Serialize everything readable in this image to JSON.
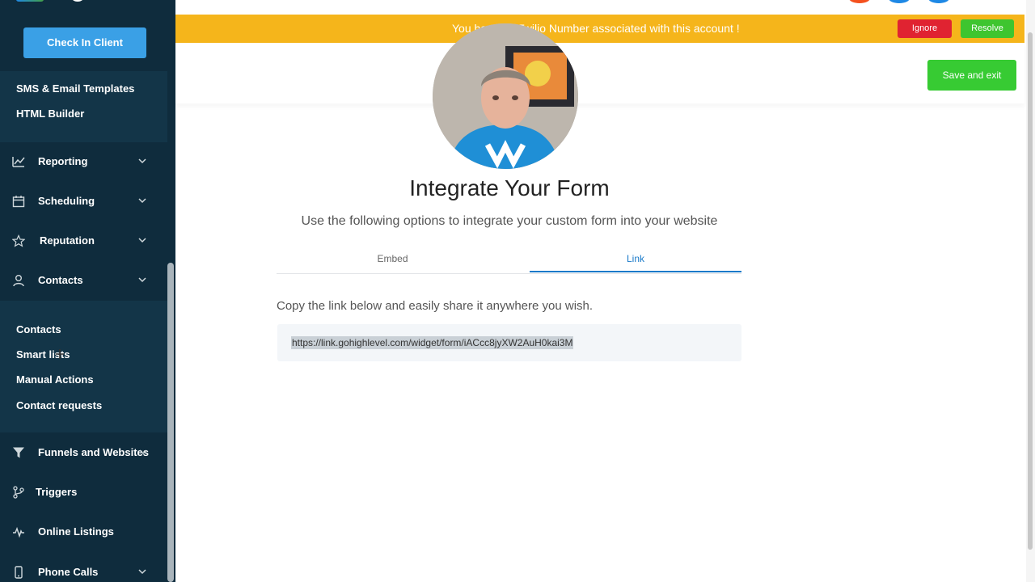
{
  "sidebar": {
    "check_in_label": "Check In Client",
    "marketing_sub_items": [
      "SMS & Email Templates",
      "HTML Builder"
    ],
    "nav": {
      "reporting": "Reporting",
      "scheduling": "Scheduling",
      "reputation": "Reputation",
      "contacts": "Contacts",
      "funnels": "Funnels and Websites",
      "triggers": "Triggers",
      "online_listings": "Online Listings",
      "phone_calls": "Phone Calls"
    },
    "contacts_sub_items": [
      "Contacts",
      "Smart lists",
      "Manual Actions",
      "Contact requests"
    ]
  },
  "banner": {
    "text": "You have no Twilio Number associated with this account !",
    "ignore_label": "Ignore",
    "resolve_label": "Resolve"
  },
  "header": {
    "save_exit_label": "Save and exit"
  },
  "main": {
    "title": "Integrate Your Form",
    "subtitle": "Use the following options to integrate your custom form into your website",
    "tabs": [
      {
        "label": "Embed",
        "active": false
      },
      {
        "label": "Link",
        "active": true
      }
    ],
    "instruction": "Copy the link below and easily share it anywhere you wish.",
    "link_url": "https://link.gohighlevel.com/widget/form/iACcc8jyXW2AuH0kai3M"
  },
  "colors": {
    "sidebar_bg": "#0f2c3d",
    "banner": "#f5b51b",
    "ignore": "#e02331",
    "resolve": "#3ec52f",
    "save": "#37cb33",
    "accent": "#1a7ac9"
  }
}
